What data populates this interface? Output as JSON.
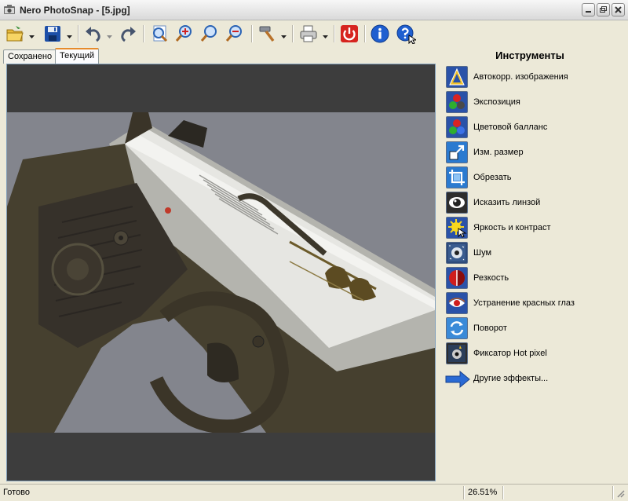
{
  "window": {
    "title": "Nero PhotoSnap - [5.jpg]"
  },
  "tabs": [
    {
      "label": "Сохранено",
      "active": false
    },
    {
      "label": "Текущий",
      "active": true
    }
  ],
  "panel": {
    "title": "Инструменты",
    "tools": [
      {
        "label": "Автокорр. изображения",
        "icon": "auto-correct-icon"
      },
      {
        "label": "Экспозиция",
        "icon": "exposure-icon"
      },
      {
        "label": "Цветовой балланс",
        "icon": "color-balance-icon"
      },
      {
        "label": "Изм. размер",
        "icon": "resize-icon"
      },
      {
        "label": "Обрезать",
        "icon": "crop-icon"
      },
      {
        "label": "Исказить линзой",
        "icon": "lens-distort-icon"
      },
      {
        "label": "Яркость и контраст",
        "icon": "brightness-contrast-icon"
      },
      {
        "label": "Шум",
        "icon": "noise-icon"
      },
      {
        "label": "Резкость",
        "icon": "sharpness-icon"
      },
      {
        "label": "Устранение красных глаз",
        "icon": "red-eye-icon"
      },
      {
        "label": "Поворот",
        "icon": "rotate-icon"
      },
      {
        "label": "Фиксатор Hot pixel",
        "icon": "hot-pixel-icon"
      }
    ],
    "more_effects": "Другие эффекты..."
  },
  "status": {
    "text": "Готово",
    "zoom": "26.51%"
  },
  "colors": {
    "accent_tab": "#e68b2c",
    "viewport_bg": "#3d3d3d",
    "chrome": "#ece9d8"
  }
}
